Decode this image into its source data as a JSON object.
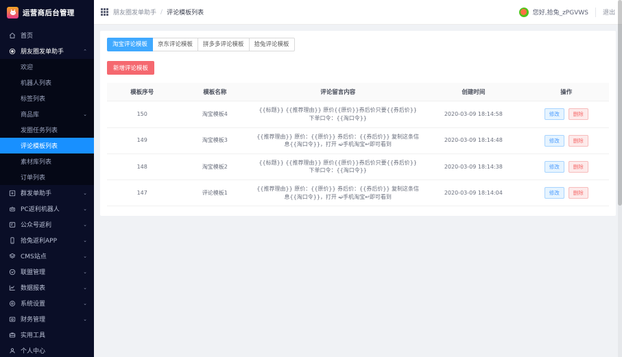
{
  "brand": {
    "title": "运营商后台管理",
    "logo_icon": "rabbit-logo-icon"
  },
  "sidebar": {
    "items": [
      {
        "label": "首页",
        "icon": "home-icon",
        "expandable": false,
        "active": false
      },
      {
        "label": "朋友圈发单助手",
        "icon": "circle-dot-icon",
        "expandable": true,
        "expanded": true,
        "active": false
      }
    ],
    "sub_items": [
      {
        "label": "欢迎",
        "expandable": false,
        "active": false
      },
      {
        "label": "机器人列表",
        "expandable": false,
        "active": false
      },
      {
        "label": "标签列表",
        "expandable": false,
        "active": false
      },
      {
        "label": "商品库",
        "expandable": true,
        "active": false
      },
      {
        "label": "发圈任务列表",
        "expandable": false,
        "active": false
      },
      {
        "label": "评论模板列表",
        "expandable": false,
        "active": true
      },
      {
        "label": "素材库列表",
        "expandable": false,
        "active": false
      },
      {
        "label": "订单列表",
        "expandable": false,
        "active": false
      }
    ],
    "bottom_items": [
      {
        "label": "群发单助手",
        "icon": "plus-box-icon",
        "expandable": true
      },
      {
        "label": "PC返利机器人",
        "icon": "robot-icon",
        "expandable": true
      },
      {
        "label": "公众号返利",
        "icon": "megaphone-icon",
        "expandable": true
      },
      {
        "label": "拾兔返利APP",
        "icon": "mobile-icon",
        "expandable": true
      },
      {
        "label": "CMS站点",
        "icon": "layers-icon",
        "expandable": true
      },
      {
        "label": "联盟管理",
        "icon": "target-icon",
        "expandable": true
      },
      {
        "label": "数据报表",
        "icon": "chart-icon",
        "expandable": true
      },
      {
        "label": "系统设置",
        "icon": "gear-icon",
        "expandable": true
      },
      {
        "label": "财务管理",
        "icon": "wallet-icon",
        "expandable": true
      },
      {
        "label": "实用工具",
        "icon": "toolbox-icon",
        "expandable": false
      },
      {
        "label": "个人中心",
        "icon": "user-icon",
        "expandable": false
      }
    ],
    "chevron_collapsed": "⌄",
    "chevron_expanded": "⌃"
  },
  "topbar": {
    "menu_icon": "grid-menu-icon",
    "breadcrumb_parent": "朋友圈发单助手",
    "breadcrumb_sep": "/",
    "breadcrumb_current": "评论模板列表",
    "avatar_icon": "user-avatar",
    "greeting": "您好,拾兔_zPGVWS",
    "logout_label": "退出"
  },
  "tabs": [
    {
      "label": "淘宝评论模板",
      "active": true
    },
    {
      "label": "京东评论模板",
      "active": false
    },
    {
      "label": "拼多多评论模板",
      "active": false
    },
    {
      "label": "拾兔评论模板",
      "active": false
    }
  ],
  "actions": {
    "add_label": "新增评论模板"
  },
  "table": {
    "headers": [
      "模板序号",
      "模板名称",
      "评论留言内容",
      "创建时间",
      "操作"
    ],
    "rows": [
      {
        "id": "150",
        "name": "淘宝模板4",
        "content": "{{标题}} {{推荐理由}} 原价{{原价}}券后价只要{{券后价}} 下单口令：{{淘口令}}",
        "time": "2020-03-09 18:14:58",
        "edit_label": "修改",
        "delete_label": "删除"
      },
      {
        "id": "149",
        "name": "淘宝模板3",
        "content": "{{推荐理由}} 原价：{{原价}} 券后价：{{券后价}} 复制这条信息{{淘口令}}，打开 ➫手机淘宝↩即可看到",
        "time": "2020-03-09 18:14:48",
        "edit_label": "修改",
        "delete_label": "删除"
      },
      {
        "id": "148",
        "name": "淘宝模板2",
        "content": "{{标题}} {{推荐理由}} 原价{{原价}}券后价只要{{券后价}} 下单口令：{{淘口令}}",
        "time": "2020-03-09 18:14:38",
        "edit_label": "修改",
        "delete_label": "删除"
      },
      {
        "id": "147",
        "name": "评论模板1",
        "content": "{{推荐理由}} 原价：{{原价}} 券后价：{{券后价}} 复制这条信息{{淘口令}}，打开 ➫手机淘宝↩即可看到",
        "time": "2020-03-09 18:14:04",
        "edit_label": "修改",
        "delete_label": "删除"
      }
    ]
  },
  "colors": {
    "sidebar_bg": "#0a0e27",
    "sidebar_sub_bg": "#050816",
    "active_blue": "#1890ff",
    "tab_active": "#40a9ff",
    "primary_red": "#f5686f",
    "content_bg": "#f0f2f5"
  }
}
